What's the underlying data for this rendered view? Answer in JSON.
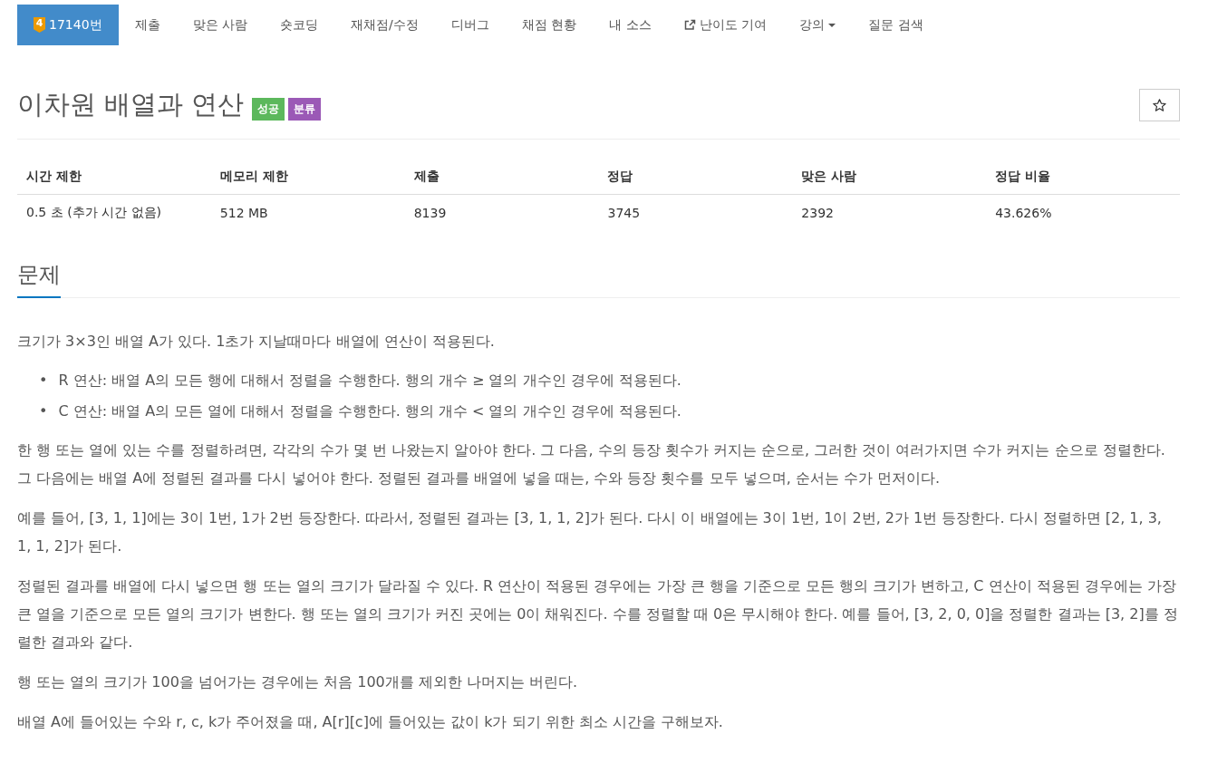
{
  "nav": {
    "tabs": [
      {
        "kind": "problem",
        "tier": "4",
        "label": "17140번",
        "selected": true
      },
      {
        "kind": "plain",
        "label": "제출",
        "selected": false
      },
      {
        "kind": "plain",
        "label": "맞은 사람",
        "selected": false
      },
      {
        "kind": "plain",
        "label": "숏코딩",
        "selected": false
      },
      {
        "kind": "plain",
        "label": "재채점/수정",
        "selected": false
      },
      {
        "kind": "plain",
        "label": "디버그",
        "selected": false
      },
      {
        "kind": "plain",
        "label": "채점 현황",
        "selected": false
      },
      {
        "kind": "plain",
        "label": "내 소스",
        "selected": false
      },
      {
        "kind": "external",
        "label": "난이도 기여",
        "selected": false
      },
      {
        "kind": "dropdown",
        "label": "강의",
        "selected": false
      },
      {
        "kind": "plain",
        "label": "질문 검색",
        "selected": false
      }
    ]
  },
  "problem": {
    "title": "이차원 배열과 연산",
    "badges": [
      {
        "label": "성공",
        "color": "#5cb85c"
      },
      {
        "label": "분류",
        "color": "#9b59b6"
      }
    ]
  },
  "stats_table": {
    "columns": [
      "시간 제한",
      "메모리 제한",
      "제출",
      "정답",
      "맞은 사람",
      "정답 비율"
    ],
    "rows": [
      [
        "0.5 초 (추가 시간 없음)",
        "512 MB",
        "8139",
        "3745",
        "2392",
        "43.626%"
      ]
    ]
  },
  "section": {
    "heading": "문제",
    "blocks": [
      {
        "kind": "paragraph",
        "text": "크기가 3×3인 배열 A가 있다. 1초가 지날때마다 배열에 연산이 적용된다."
      },
      {
        "kind": "list",
        "items": [
          {
            "marker": "•",
            "text": "R 연산: 배열 A의 모든 행에 대해서 정렬을 수행한다. 행의 개수 ≥ 열의 개수인 경우에 적용된다."
          },
          {
            "marker": "•",
            "text": "C 연산: 배열 A의 모든 열에 대해서 정렬을 수행한다. 행의 개수 < 열의 개수인 경우에 적용된다."
          }
        ]
      },
      {
        "kind": "paragraph",
        "text": "한 행 또는 열에 있는 수를 정렬하려면, 각각의 수가 몇 번 나왔는지 알아야 한다. 그 다음, 수의 등장 횟수가 커지는 순으로, 그러한 것이 여러가지면 수가 커지는 순으로 정렬한다. 그 다음에는 배열 A에 정렬된 결과를 다시 넣어야 한다. 정렬된 결과를 배열에 넣을 때는, 수와 등장 횟수를 모두 넣으며, 순서는 수가 먼저이다."
      },
      {
        "kind": "paragraph",
        "text": "예를 들어, [3, 1, 1]에는 3이 1번, 1가 2번 등장한다. 따라서, 정렬된 결과는 [3, 1, 1, 2]가 된다. 다시 이 배열에는 3이 1번, 1이 2번, 2가 1번 등장한다. 다시 정렬하면 [2, 1, 3, 1, 1, 2]가 된다."
      },
      {
        "kind": "paragraph",
        "text": "정렬된 결과를 배열에 다시 넣으면 행 또는 열의 크기가 달라질 수 있다. R 연산이 적용된 경우에는 가장 큰 행을 기준으로 모든 행의 크기가 변하고, C 연산이 적용된 경우에는 가장 큰 열을 기준으로 모든 열의 크기가 변한다. 행 또는 열의 크기가 커진 곳에는 0이 채워진다. 수를 정렬할 때 0은 무시해야 한다. 예를 들어, [3, 2, 0, 0]을 정렬한 결과는 [3, 2]를 정렬한 결과와 같다."
      },
      {
        "kind": "paragraph",
        "text": "행 또는 열의 크기가 100을 넘어가는 경우에는 처음 100개를 제외한 나머지는 버린다."
      },
      {
        "kind": "paragraph",
        "text": "배열 A에 들어있는 수와 r, c, k가 주어졌을 때, A[r][c]에 들어있는 값이 k가 되기 위한 최소 시간을 구해보자."
      }
    ]
  }
}
